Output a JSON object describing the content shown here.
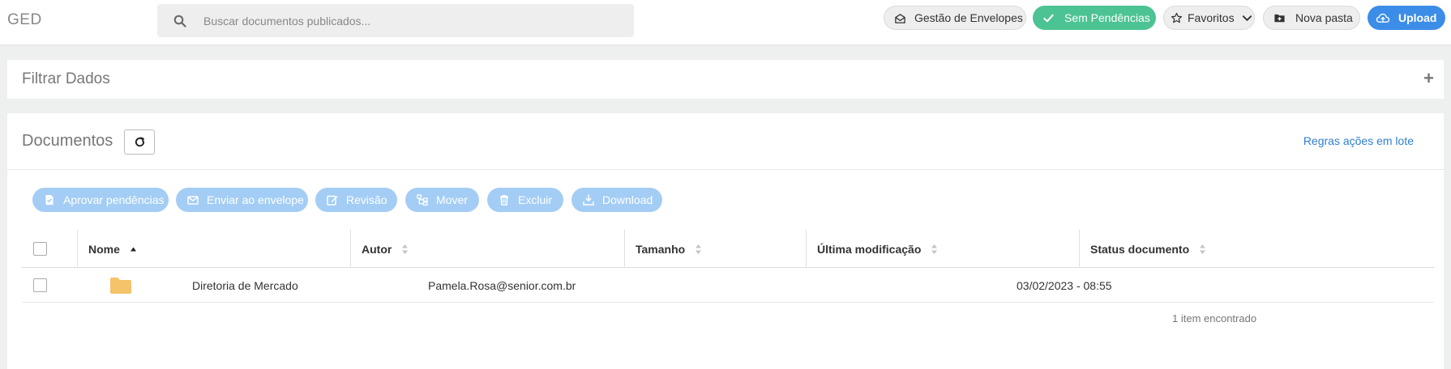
{
  "app": {
    "title": "GED"
  },
  "search": {
    "placeholder": "Buscar documentos publicados...",
    "icon": "search-icon"
  },
  "header_actions": {
    "envelopes": "Gestão de Envelopes",
    "pending": "Sem Pendências",
    "favorites": "Favoritos",
    "new_folder": "Nova pasta",
    "upload": "Upload"
  },
  "colors": {
    "pending_green": "#4cc392",
    "upload_blue": "#3c8de8",
    "action_disabled": "#a3cdf5",
    "link_blue": "#2f7fd1"
  },
  "filter": {
    "title": "Filtrar Dados",
    "toggle": "+"
  },
  "documents": {
    "title": "Documentos",
    "bulk_rules": "Regras ações em lote",
    "actions": {
      "approve": "Aprovar pendências",
      "send_envelope": "Enviar ao envelope",
      "revision": "Revisão",
      "move": "Mover",
      "delete": "Excluir",
      "download": "Download"
    },
    "columns": {
      "name": "Nome",
      "author": "Autor",
      "size": "Tamanho",
      "modified": "Última modificação",
      "status": "Status documento"
    },
    "rows": [
      {
        "name": "Diretoria de Mercado",
        "author": "Pamela.Rosa@senior.com.br",
        "size": "",
        "modified": "03/02/2023 - 08:55",
        "status": ""
      }
    ],
    "count_text": "1 item encontrado"
  }
}
